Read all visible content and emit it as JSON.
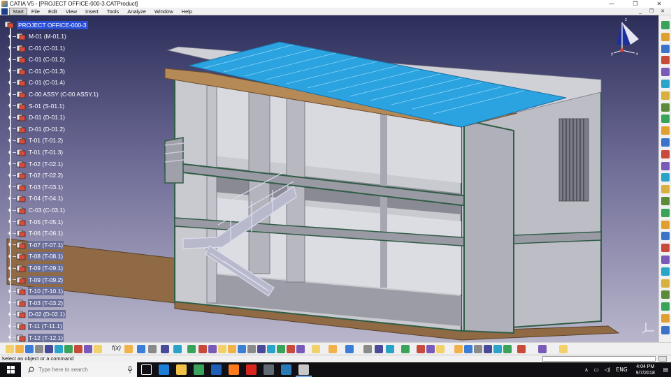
{
  "window": {
    "title": "CATIA V5 - [PROJECT OFFICE-000-3.CATProduct]",
    "controls": [
      "—",
      "❐",
      "✕"
    ]
  },
  "menubar": {
    "items": [
      "Start",
      "File",
      "Edit",
      "View",
      "Insert",
      "Tools",
      "Analyze",
      "Window",
      "Help"
    ],
    "mdi_controls": [
      "_",
      "❐",
      "✕"
    ]
  },
  "spec_tree": {
    "root": "PROJECT OFFICE-000-3",
    "items": [
      {
        "label": "M-01 (M-01.1)",
        "highlighted": false
      },
      {
        "label": "C-01 (C-01.1)",
        "highlighted": false
      },
      {
        "label": "C-01 (C-01.2)",
        "highlighted": false
      },
      {
        "label": "C-01 (C-01.3)",
        "highlighted": false
      },
      {
        "label": "C-01 (C-01.4)",
        "highlighted": false
      },
      {
        "label": "C-00 ASSY (C-00 ASSY.1)",
        "highlighted": false
      },
      {
        "label": "S-01 (S-01.1)",
        "highlighted": false
      },
      {
        "label": "D-01 (D-01.1)",
        "highlighted": false
      },
      {
        "label": "D-01 (D-01.2)",
        "highlighted": false
      },
      {
        "label": "T-01 (T-01.2)",
        "highlighted": false
      },
      {
        "label": "T-01 (T-01.3)",
        "highlighted": false
      },
      {
        "label": "T-02 (T-02.1)",
        "highlighted": false
      },
      {
        "label": "T-02 (T-02.2)",
        "highlighted": false
      },
      {
        "label": "T-03 (T-03.1)",
        "highlighted": false
      },
      {
        "label": "T-04 (T-04.1)",
        "highlighted": false
      },
      {
        "label": "C-03 (C-03.1)",
        "highlighted": false
      },
      {
        "label": "T-05 (T-05.1)",
        "highlighted": false
      },
      {
        "label": "T-06 (T-06.1)",
        "highlighted": false
      },
      {
        "label": "T-07 (T-07.1)",
        "highlighted": true
      },
      {
        "label": "T-08 (T-08.1)",
        "highlighted": true
      },
      {
        "label": "T-09 (T-09.1)",
        "highlighted": true
      },
      {
        "label": "T-09 (T-09.2)",
        "highlighted": true
      },
      {
        "label": "T-10 (T-10.1)",
        "highlighted": true
      },
      {
        "label": "T-03 (T-03.2)",
        "highlighted": true
      },
      {
        "label": "D-02 (D-02.1)",
        "highlighted": true
      },
      {
        "label": "T-11 (T-11.1)",
        "highlighted": true
      },
      {
        "label": "T-12 (T-12.1)",
        "highlighted": true
      }
    ]
  },
  "compass": {
    "axis_labels": [
      "z",
      "x",
      "y"
    ]
  },
  "bottom_toolbar": {
    "fx_label": "f(x)"
  },
  "status": {
    "prompt": "Select an object or a command",
    "command_value": ""
  },
  "taskbar": {
    "search_placeholder": "Type here to search",
    "apps": [
      "task-view",
      "edge",
      "file-explorer",
      "chrome",
      "outlook",
      "illustrator",
      "acrobat",
      "calculator",
      "remote",
      "catia"
    ],
    "language": "ENG",
    "time": "4:04 PM",
    "date": "9/7/2018"
  },
  "colors": {
    "tree_selection": "#2a4fd6",
    "roof_sheet": "#2aa3e0",
    "background_top": "#2c2e5a",
    "background_bottom": "#b9b6cc"
  }
}
